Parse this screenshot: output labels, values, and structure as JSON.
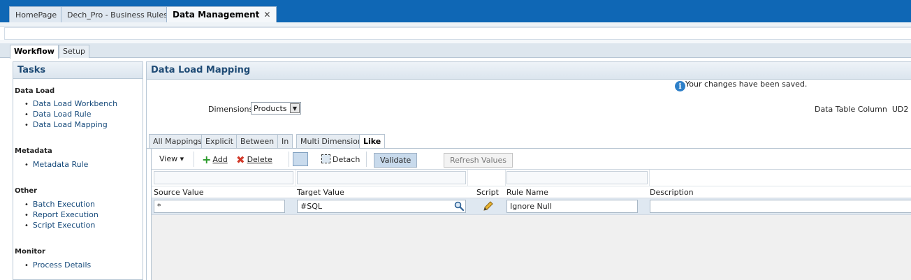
{
  "top_tabs": [
    {
      "label": "HomePage"
    },
    {
      "label": "Dech_Pro - Business Rules"
    },
    {
      "label": "Data Management",
      "close": "✕"
    }
  ],
  "subtabs": {
    "workflow": "Workflow",
    "setup": "Setup"
  },
  "tasks": {
    "title": "Tasks",
    "groups": [
      {
        "name": "Data Load",
        "items": [
          "Data Load Workbench",
          "Data Load Rule",
          "Data Load Mapping"
        ]
      },
      {
        "name": "Metadata",
        "items": [
          "Metadata Rule"
        ]
      },
      {
        "name": "Other",
        "items": [
          "Batch Execution",
          "Report Execution",
          "Script Execution"
        ]
      },
      {
        "name": "Monitor",
        "items": [
          "Process Details"
        ]
      }
    ]
  },
  "main": {
    "title": "Data Load Mapping",
    "info_message": "Your changes have been saved.",
    "dimensions_label": "Dimensions",
    "dimensions_value": "Products",
    "data_table_column_label": "Data Table Column",
    "data_table_column_value": "UD2",
    "mapping_tabs": [
      "All Mappings",
      "Explicit",
      "Between",
      "In",
      "Multi Dimension",
      "Like"
    ],
    "active_tab": "Like"
  },
  "toolbar": {
    "view": "View",
    "add": "Add",
    "delete": "Delete",
    "detach": "Detach",
    "validate": "Validate",
    "refresh": "Refresh Values"
  },
  "table": {
    "columns": [
      "Source Value",
      "Target Value",
      "Script",
      "Rule Name",
      "Description"
    ],
    "rows": [
      {
        "source": "*",
        "target": "#SQL",
        "script": "pencil-icon",
        "rule_name": "Ignore Null",
        "description": ""
      }
    ]
  },
  "colors": {
    "brand_bar": "#0f67b5",
    "link": "#15497a",
    "panel_title": "#1f4b75"
  }
}
